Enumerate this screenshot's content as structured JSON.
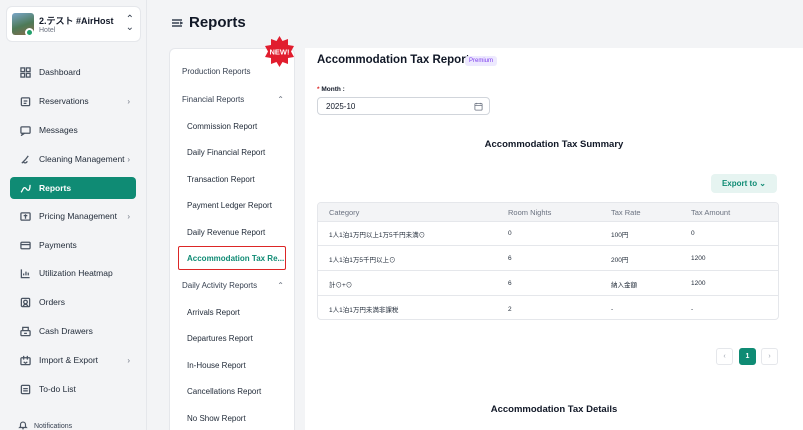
{
  "property": {
    "name": "2.テスト #AirHost",
    "type": "Hotel"
  },
  "nav": [
    {
      "label": "Dashboard",
      "icon": "dashboard-icon"
    },
    {
      "label": "Reservations",
      "icon": "calendar-icon",
      "arrow": "›"
    },
    {
      "label": "Messages",
      "icon": "message-icon"
    },
    {
      "label": "Cleaning Management",
      "icon": "broom-icon",
      "arrow": "›"
    },
    {
      "label": "Reports",
      "icon": "chart-icon",
      "active": true
    },
    {
      "label": "Pricing Management",
      "icon": "price-icon",
      "arrow": "›"
    },
    {
      "label": "Payments",
      "icon": "card-icon"
    },
    {
      "label": "Utilization Heatmap",
      "icon": "heatmap-icon"
    },
    {
      "label": "Orders",
      "icon": "order-icon"
    },
    {
      "label": "Cash Drawers",
      "icon": "cash-drawer-icon"
    },
    {
      "label": "Import & Export",
      "icon": "import-export-icon",
      "arrow": "›"
    },
    {
      "label": "To-do List",
      "icon": "todo-icon"
    }
  ],
  "notifications_label": "Notifications",
  "header": {
    "title": "Reports"
  },
  "badge": {
    "text": "NEW!"
  },
  "report_list": [
    {
      "label": "Production Reports",
      "kind": "top"
    },
    {
      "label": "Financial Reports",
      "kind": "top",
      "caret": "⌃"
    },
    {
      "label": "Commission Report",
      "kind": "sub"
    },
    {
      "label": "Daily Financial Report",
      "kind": "sub"
    },
    {
      "label": "Transaction Report",
      "kind": "sub"
    },
    {
      "label": "Payment Ledger Report",
      "kind": "sub"
    },
    {
      "label": "Daily Revenue Report",
      "kind": "sub"
    },
    {
      "label": "Accommodation Tax Re...",
      "kind": "selected"
    },
    {
      "label": "Daily Activity Reports",
      "kind": "top",
      "caret": "⌃"
    },
    {
      "label": "Arrivals Report",
      "kind": "sub"
    },
    {
      "label": "Departures Report",
      "kind": "sub"
    },
    {
      "label": "In-House Report",
      "kind": "sub"
    },
    {
      "label": "Cancellations Report",
      "kind": "sub"
    },
    {
      "label": "No Show Report",
      "kind": "sub"
    }
  ],
  "report": {
    "title": "Accommodation Tax Report",
    "premium": "Premium",
    "month_required": "*",
    "month_label": "Month :",
    "month_value": "2025-10",
    "summary_title": "Accommodation Tax Summary",
    "export_label": "Export to ⌄",
    "columns": [
      "Category",
      "Room Nights",
      "Tax Rate",
      "Tax Amount"
    ],
    "rows": [
      [
        "1人1泊1万円以上1万5千円未満⊙",
        "0",
        "100円",
        "0"
      ],
      [
        "1人1泊1万5千円以上⊙",
        "6",
        "200円",
        "1200"
      ],
      [
        "計⊙+⊙",
        "6",
        "納入金額",
        "1200"
      ],
      [
        "1人1泊1万円未満非課税",
        "2",
        "-",
        "-"
      ]
    ],
    "pagination": {
      "prev": "‹",
      "current": "1",
      "next": "›"
    },
    "details_title": "Accommodation Tax Details"
  }
}
